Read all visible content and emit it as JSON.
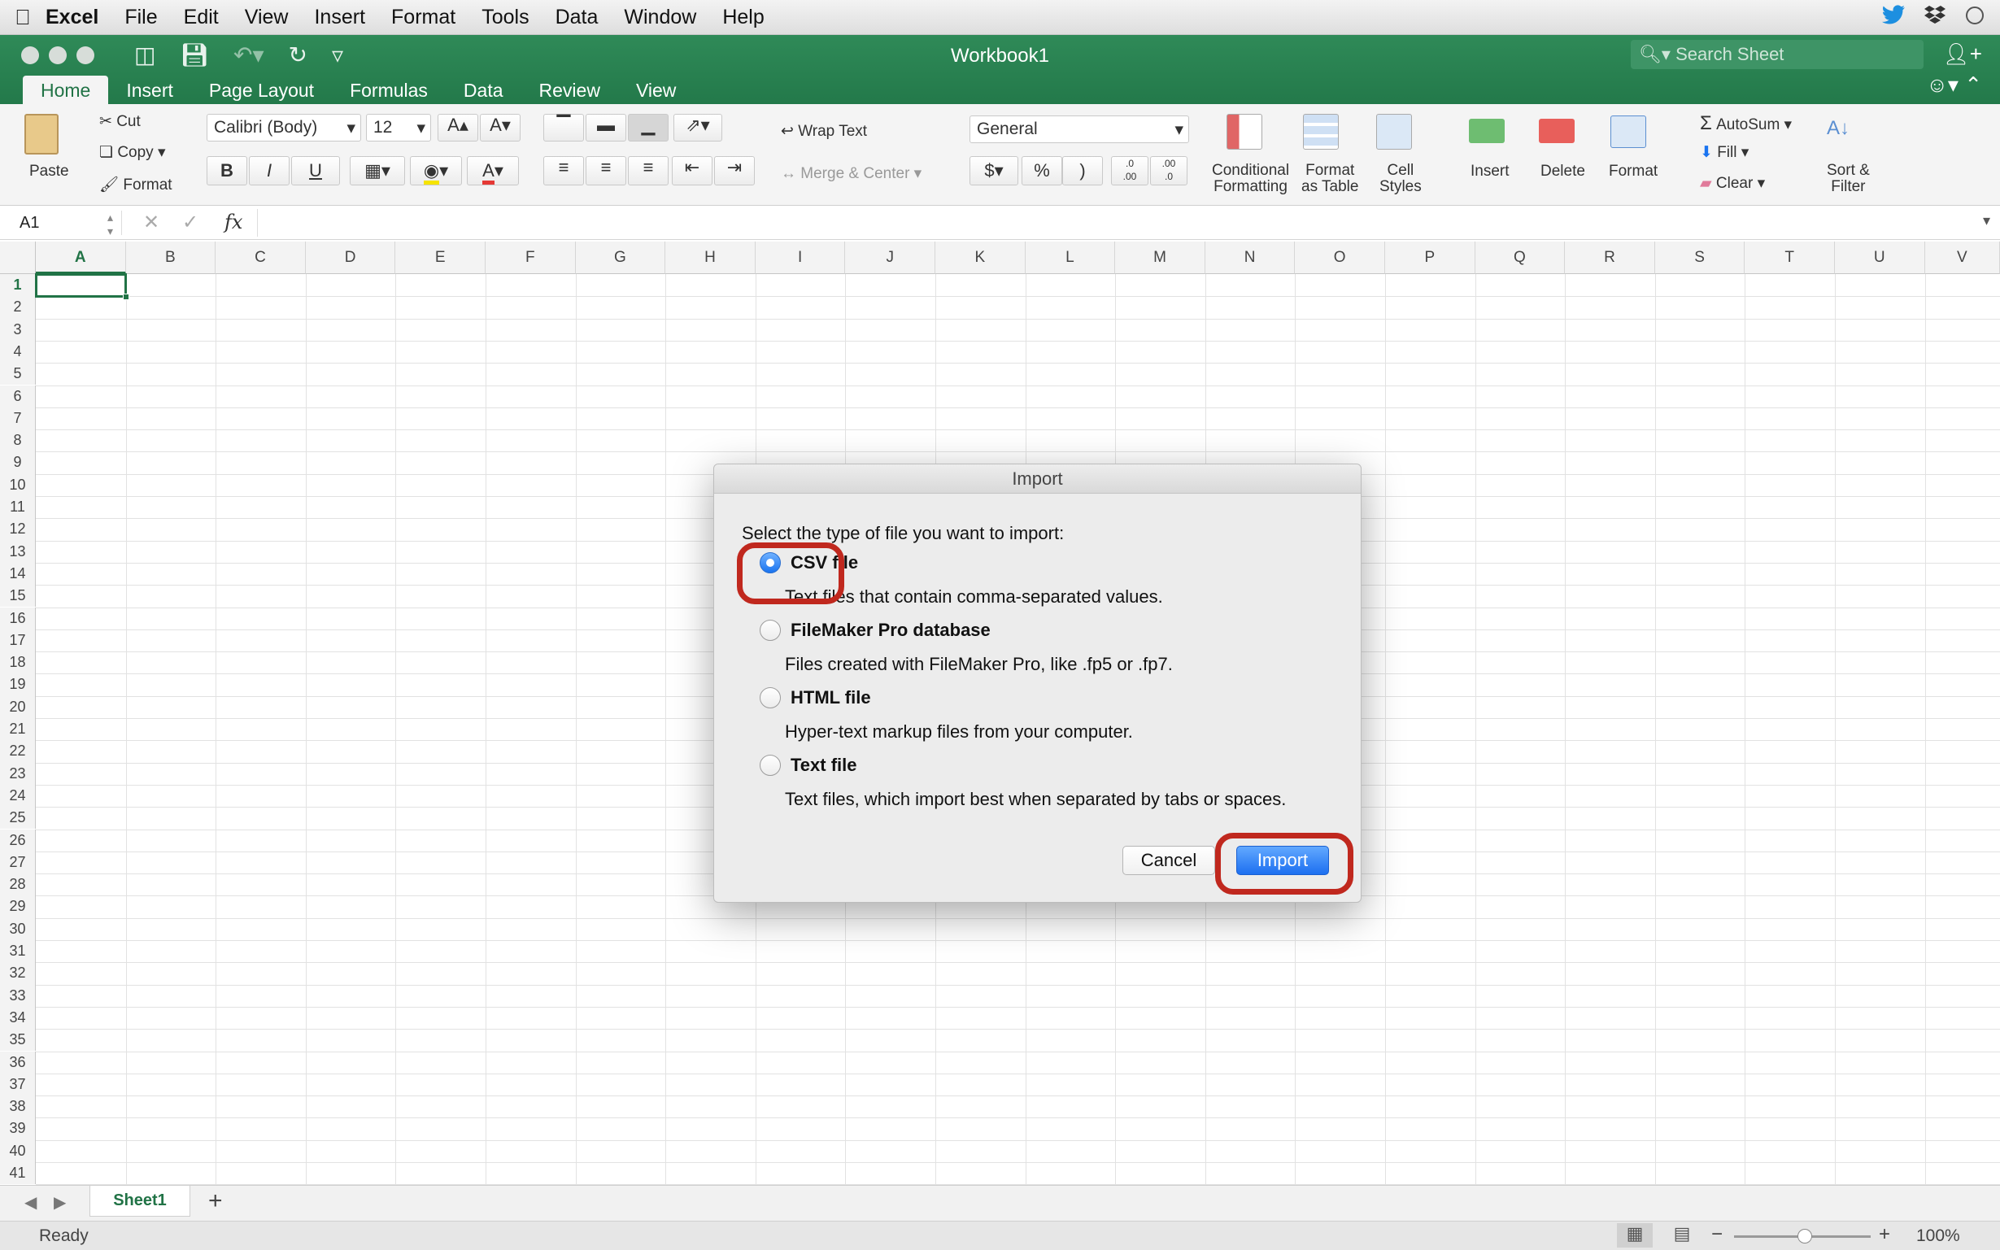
{
  "menubar": {
    "app": "Excel",
    "items": [
      "File",
      "Edit",
      "View",
      "Insert",
      "Format",
      "Tools",
      "Data",
      "Window",
      "Help"
    ]
  },
  "window": {
    "title": "Workbook1",
    "search_placeholder": "Search Sheet"
  },
  "ribbon": {
    "tabs": [
      "Home",
      "Insert",
      "Page Layout",
      "Formulas",
      "Data",
      "Review",
      "View"
    ],
    "active_tab": "Home",
    "clipboard": {
      "paste": "Paste",
      "cut": "Cut",
      "copy": "Copy",
      "format": "Format"
    },
    "font": {
      "name": "Calibri (Body)",
      "size": "12",
      "bold": "B",
      "italic": "I",
      "underline": "U"
    },
    "alignment": {
      "wrap_text": "Wrap Text",
      "merge_center": "Merge & Center"
    },
    "number": {
      "format": "General",
      "currency": "$",
      "percent": "%",
      "comma": ")",
      "inc_dec": ".0\n.00",
      "dec_dec": ".00\n.0"
    },
    "styles": {
      "conditional": "Conditional\nFormatting",
      "format_table": "Format\nas Table",
      "cell_styles": "Cell\nStyles"
    },
    "cells": {
      "insert": "Insert",
      "delete": "Delete",
      "format": "Format"
    },
    "editing": {
      "autosum": "AutoSum",
      "fill": "Fill",
      "clear": "Clear",
      "sort_filter": "Sort &\nFilter"
    }
  },
  "formula_bar": {
    "cell_ref": "A1",
    "fx": "fx",
    "content": ""
  },
  "grid": {
    "columns": [
      "A",
      "B",
      "C",
      "D",
      "E",
      "F",
      "G",
      "H",
      "I",
      "J",
      "K",
      "L",
      "M",
      "N",
      "O",
      "P",
      "Q",
      "R",
      "S",
      "T",
      "U",
      "V"
    ],
    "rows": [
      "1",
      "2",
      "3",
      "4",
      "5",
      "6",
      "7",
      "8",
      "9",
      "10",
      "11",
      "12",
      "13",
      "14",
      "15",
      "16",
      "17",
      "18",
      "19",
      "20",
      "21",
      "22",
      "23",
      "24",
      "25",
      "26",
      "27",
      "28",
      "29",
      "30",
      "31",
      "32",
      "33",
      "34",
      "35",
      "36",
      "37",
      "38",
      "39",
      "40",
      "41"
    ],
    "selected_cell": "A1"
  },
  "sheets": {
    "tabs": [
      "Sheet1"
    ],
    "add": "+"
  },
  "status": {
    "text": "Ready",
    "zoom": "100%",
    "minus": "−",
    "plus": "+"
  },
  "dialog": {
    "title": "Import",
    "prompt": "Select the type of file you want to import:",
    "options": [
      {
        "label": "CSV file",
        "desc": "Text files that contain comma-separated values.",
        "selected": true
      },
      {
        "label": "FileMaker Pro database",
        "desc": "Files created with FileMaker Pro, like .fp5 or .fp7.",
        "selected": false
      },
      {
        "label": "HTML file",
        "desc": "Hyper-text markup files from your computer.",
        "selected": false
      },
      {
        "label": "Text file",
        "desc": "Text files, which import best when separated by tabs or spaces.",
        "selected": false
      }
    ],
    "cancel": "Cancel",
    "import": "Import"
  },
  "colors": {
    "excel_green": "#217346",
    "highlight": "#c0281e",
    "accent_blue": "#1a74f0"
  }
}
